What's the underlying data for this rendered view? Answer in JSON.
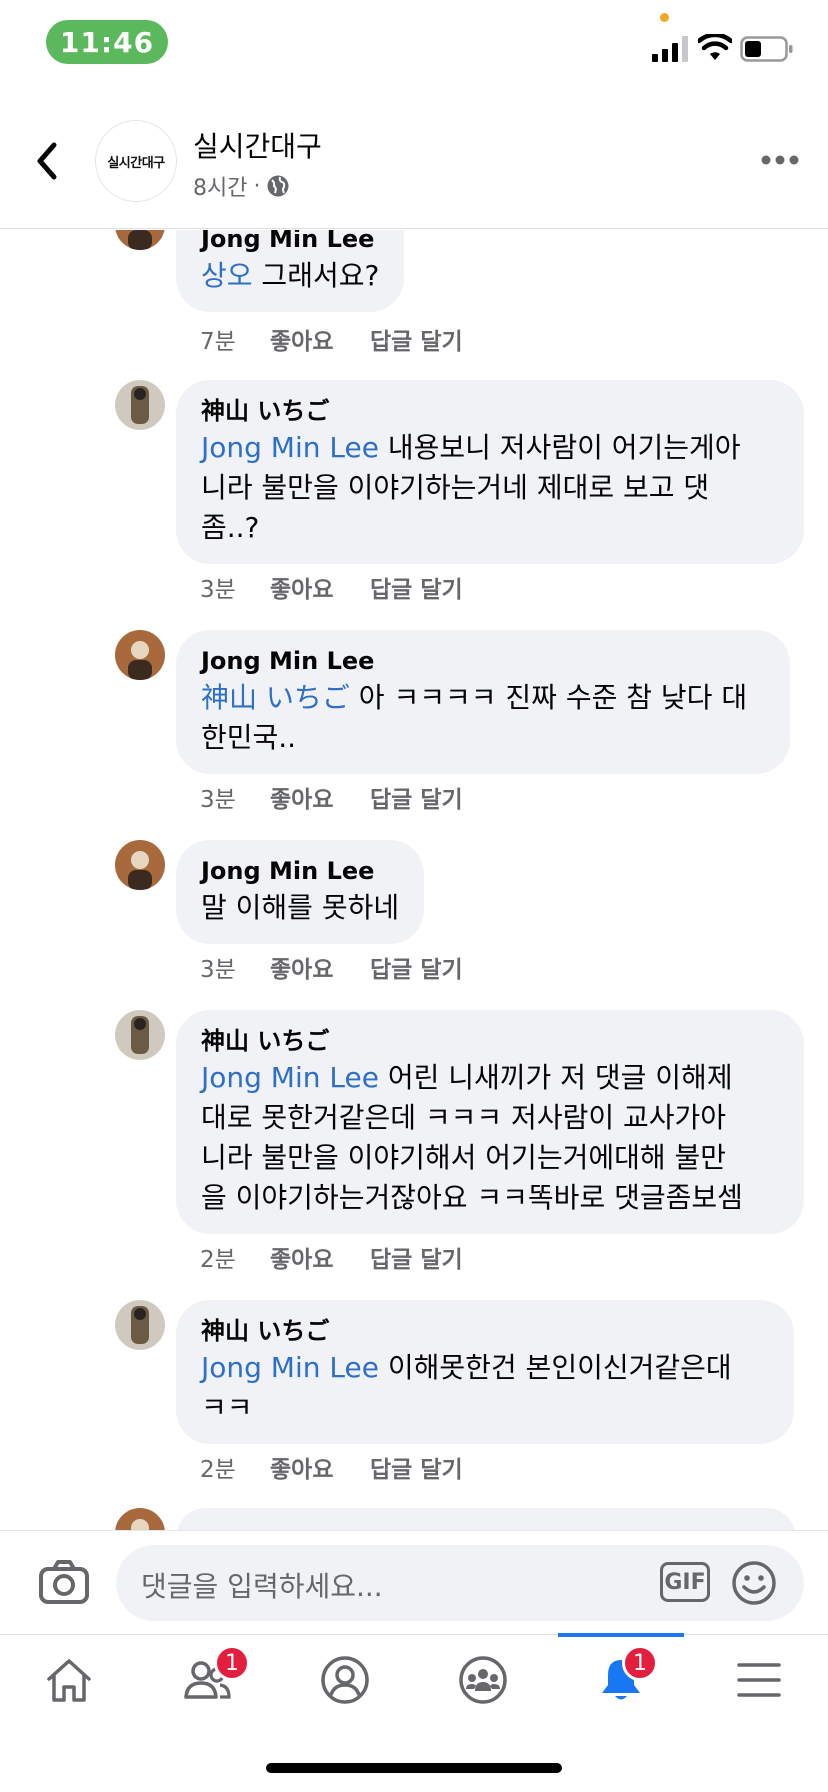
{
  "status_bar": {
    "time": "11:46"
  },
  "header": {
    "page_name": "실시간대구",
    "avatar_text": "실시간대구",
    "meta_time": "8시간",
    "meta_sep": "·"
  },
  "comments": [
    {
      "author": "Jong Min Lee",
      "mention": "상오",
      "text": " 그래서요?",
      "time": "7분",
      "like": "좋아요",
      "reply": "답글 달기"
    },
    {
      "author": "神山 いちご",
      "mention": "Jong Min Lee",
      "text": " 내용보니 저사람이 어기는게아\n니라 불만을 이야기하는거네 제대로 보고 댓\n좀..?",
      "time": "3분",
      "like": "좋아요",
      "reply": "답글 달기"
    },
    {
      "author": "Jong Min Lee",
      "mention": "神山 いちご",
      "text": " 아 ㅋㅋㅋㅋ 진짜 수준 참 낮다 대\n한민국..",
      "time": "3분",
      "like": "좋아요",
      "reply": "답글 달기"
    },
    {
      "author": "Jong Min Lee",
      "mention": "",
      "text": "말 이해를 못하네",
      "time": "3분",
      "like": "좋아요",
      "reply": "답글 달기"
    },
    {
      "author": "神山 いちご",
      "mention": "Jong Min Lee",
      "text": " 어린 니새끼가 저 댓글 이해제\n대로 못한거같은데 ㅋㅋㅋ 저사람이 교사가아\n니라 불만을 이야기해서 어기는거에대해 불만\n을 이야기하는거잖아요 ㅋㅋ똑바로 댓글좀보셈",
      "time": "2분",
      "like": "좋아요",
      "reply": "답글 달기"
    },
    {
      "author": "神山 いちご",
      "mention": "Jong Min Lee",
      "text": " 이해못한건 본인이신거같은대\nㅋㅋ",
      "time": "2분",
      "like": "좋아요",
      "reply": "답글 달기"
    }
  ],
  "composer": {
    "placeholder": "댓글을 입력하세요...",
    "gif_label": "GIF"
  },
  "nav": {
    "items": [
      {
        "icon": "home-icon"
      },
      {
        "icon": "friends-icon",
        "badge": "1"
      },
      {
        "icon": "profile-icon"
      },
      {
        "icon": "groups-icon"
      },
      {
        "icon": "notifications-icon",
        "badge": "1"
      },
      {
        "icon": "menu-icon"
      }
    ]
  },
  "colors": {
    "mention": "#2e6fc7",
    "accent": "#1877f2",
    "badge": "#e41e3f",
    "time_pill": "#5cb85c"
  }
}
